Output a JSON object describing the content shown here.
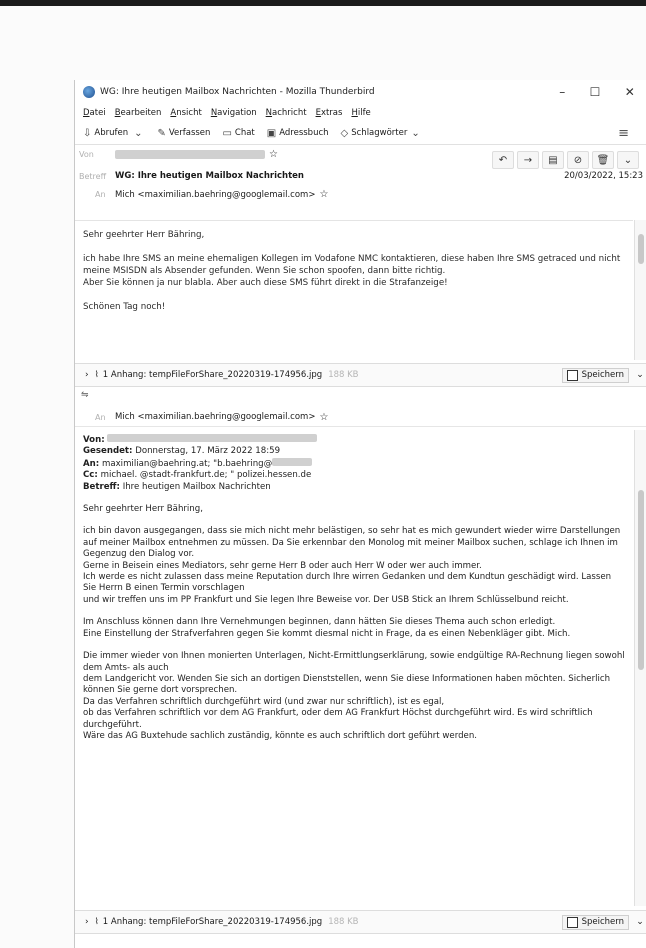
{
  "window": {
    "title": "WG: Ihre heutigen Mailbox Nachrichten - Mozilla Thunderbird",
    "controls": [
      "–",
      "☐",
      "✕"
    ]
  },
  "menu": [
    "Datei",
    "Bearbeiten",
    "Ansicht",
    "Navigation",
    "Nachricht",
    "Extras",
    "Hilfe"
  ],
  "toolbar": {
    "fetch": "Abrufen",
    "compose": "Verfassen",
    "chat": "Chat",
    "addressbook": "Adressbuch",
    "tags": "Schlagwörter"
  },
  "header": {
    "from_label": "Von",
    "subject_label": "Betreff",
    "subject": "WG: Ihre heutigen Mailbox Nachrichten",
    "date": "20/03/2022, 15:23",
    "to_label": "An",
    "to": "Mich <maximilian.baehring@googlemail.com>"
  },
  "message1": {
    "greeting": "Sehr geehrter Herr Bähring,",
    "p1": "ich habe Ihre SMS an meine ehemaligen Kollegen im Vodafone NMC kontaktieren, diese haben Ihre SMS getraced und nicht meine MSISDN als Absender gefunden. Wenn Sie schon spoofen, dann bitte richtig.",
    "p1b": "Aber Sie können ja nur blabla. Aber auch diese SMS führt direkt in die Strafanzeige!",
    "closing": "Schönen Tag noch!"
  },
  "attachment": {
    "label": "1 Anhang: tempFileForShare_20220319-174956.jpg",
    "size1": "188 KB",
    "size2": "188 KB",
    "save": "Speichern"
  },
  "header2": {
    "to_label": "An",
    "to": "Mich <maximilian.baehring@googlemail.com>"
  },
  "message2": {
    "von_label": "Von:",
    "gesendet_label": "Gesendet:",
    "gesendet": "Donnerstag, 17. März 2022 18:59",
    "an_label": "An:",
    "an": "maximilian@baehring.at; \"b.baehring@",
    "cc_label": "Cc:",
    "cc": "michael.      @stadt-frankfurt.de; \"        polizei.hessen.de",
    "betreff_label": "Betreff:",
    "betreff": "Ihre heutigen Mailbox Nachrichten",
    "greeting": "Sehr geehrter Herr Bähring,",
    "p1": "ich bin davon ausgegangen, dass sie mich nicht mehr belästigen, so sehr hat es mich gewundert wieder wirre Darstellungen",
    "p2": "auf meiner Mailbox entnehmen zu müssen. Da Sie erkennbar den Monolog mit meiner Mailbox suchen, schlage ich Ihnen im Gegenzug den Dialog vor.",
    "p3": "Gerne in Beisein eines Mediators, sehr gerne Herr B         oder auch Herr W         oder wer auch immer.",
    "p4": "Ich werde es nicht zulassen dass meine Reputation durch Ihre wirren Gedanken und dem Kundtun geschädigt wird. Lassen Sie Herrn B         einen Termin vorschlagen",
    "p5": "und wir treffen uns im PP Frankfurt und Sie legen Ihre Beweise vor. Der USB Stick an Ihrem Schlüsselbund reicht.",
    "p6": "Im Anschluss können dann Ihre Vernehmungen beginnen, dann hätten Sie dieses Thema auch schon erledigt.",
    "p7": "Eine Einstellung der Strafverfahren gegen Sie kommt diesmal nicht in Frage, da es einen Nebenkläger gibt. Mich.",
    "p8": "Die immer wieder von Ihnen monierten Unterlagen, Nicht-Ermittlungserklärung, sowie endgültige RA-Rechnung liegen sowohl dem Amts- als auch",
    "p9": "dem Landgericht vor. Wenden Sie sich an dortigen Dienststellen, wenn Sie diese Informationen haben möchten. Sicherlich können Sie gerne dort vorsprechen.",
    "p10": "Da das Verfahren schriftlich durchgeführt wird (und zwar nur schriftlich), ist es egal,",
    "p11": "ob das Verfahren schriftlich vor dem AG Frankfurt, oder dem AG Frankfurt Höchst durchgeführt wird. Es wird schriftlich durchgeführt.",
    "p12": "Wäre das AG Buxtehude sachlich zuständig, könnte es auch schriftlich dort geführt werden."
  }
}
